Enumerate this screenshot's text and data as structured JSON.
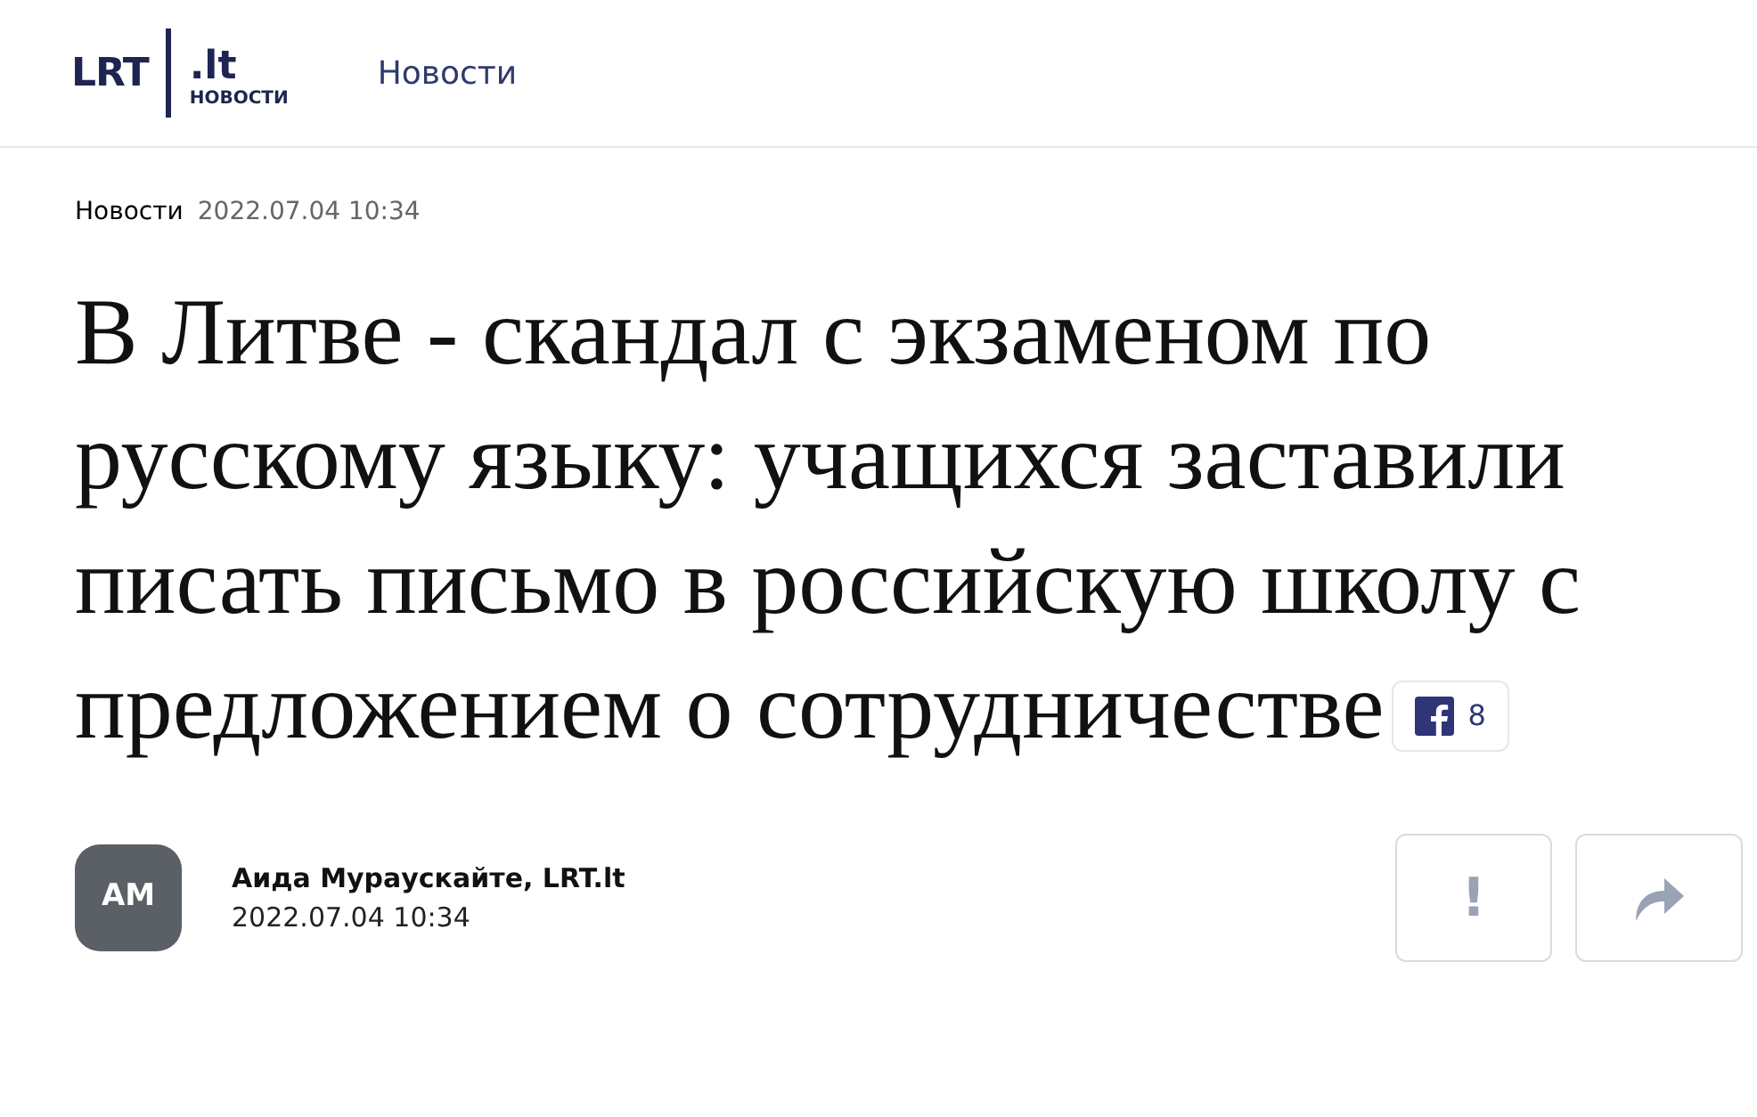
{
  "header": {
    "logo": {
      "brand": "LRT",
      "domain": ".lt",
      "section": "НОВОСТИ"
    },
    "nav": [
      {
        "label": "Новости",
        "selected": false
      }
    ]
  },
  "article": {
    "category": "Новости",
    "date": "2022.07.04 10:34",
    "title": "В Литве - скандал с экзаменом по русскому языку: учащихся заставили писать письмо в российскую школу с предложением о сотрудничестве",
    "facebook_count": "8",
    "author": {
      "initials": "AM",
      "name": "Аида Мураускайте, LRT.lt",
      "date": "2022.07.04 10:34"
    },
    "actions": [
      {
        "kind": "report",
        "label": "!"
      },
      {
        "kind": "share"
      }
    ]
  }
}
